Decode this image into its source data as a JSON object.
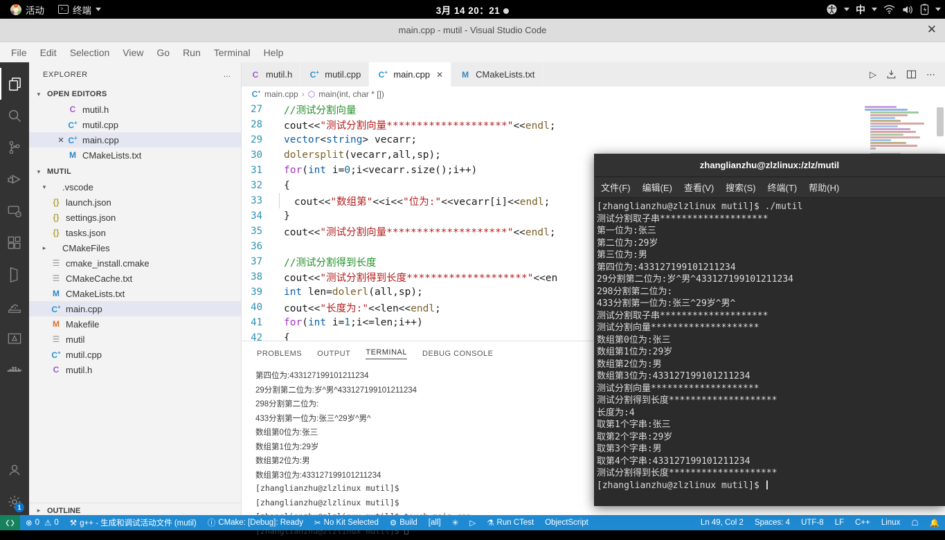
{
  "gnome_bar": {
    "activities": "活动",
    "app_menu": "终端",
    "clock": "3月 14  20：21",
    "icons": [
      "ubuntu-logo-icon",
      "terminal-icon",
      "chevron-down-icon",
      "accessibility-icon",
      "input-method-icon",
      "wifi-icon",
      "volume-icon",
      "battery-icon",
      "power-chevron-icon"
    ],
    "input_method": "中"
  },
  "vscode": {
    "title": "main.cpp - mutil - Visual Studio Code",
    "close_label": "✕",
    "menus": [
      "File",
      "Edit",
      "Selection",
      "View",
      "Go",
      "Run",
      "Terminal",
      "Help"
    ],
    "activity_bar": [
      {
        "name": "explorer",
        "icon": "files-icon",
        "active": true
      },
      {
        "name": "search",
        "icon": "search-icon",
        "active": false
      },
      {
        "name": "source-control",
        "icon": "source-control-icon",
        "active": false
      },
      {
        "name": "run-and-debug",
        "icon": "debug-icon",
        "active": false
      },
      {
        "name": "remote-explorer",
        "icon": "remote-icon",
        "active": false
      },
      {
        "name": "extensions",
        "icon": "extensions-icon",
        "active": false
      },
      {
        "name": "cmake",
        "icon": "cmake-icon",
        "active": false
      },
      {
        "name": "testing",
        "icon": "beaker-icon",
        "active": false
      },
      {
        "name": "objectscript",
        "icon": "objectscript-icon",
        "active": false
      },
      {
        "name": "docker",
        "icon": "docker-icon",
        "active": false
      }
    ],
    "activity_bar_bottom": [
      {
        "name": "accounts",
        "icon": "account-icon"
      },
      {
        "name": "manage",
        "icon": "gear-icon",
        "badge": "1"
      }
    ],
    "sidebar": {
      "title": "EXPLORER",
      "more_actions": "…",
      "open_editors": {
        "label": "OPEN EDITORS",
        "items": [
          {
            "name": "mutil.h",
            "icon": "c-file-icon",
            "selected": false,
            "closable": false
          },
          {
            "name": "mutil.cpp",
            "icon": "cpp-file-icon",
            "selected": false,
            "closable": false
          },
          {
            "name": "main.cpp",
            "icon": "cpp-file-icon",
            "selected": true,
            "closable": true
          },
          {
            "name": "CMakeLists.txt",
            "icon": "cmake-file-icon",
            "selected": false,
            "closable": false
          }
        ]
      },
      "project": {
        "label": "MUTIL",
        "items": [
          {
            "name": ".vscode",
            "icon": "folder-open-icon",
            "indent": 1,
            "twisty": "▾",
            "selected": false
          },
          {
            "name": "launch.json",
            "icon": "json-file-icon",
            "indent": 2,
            "twisty": "",
            "selected": false
          },
          {
            "name": "settings.json",
            "icon": "json-file-icon",
            "indent": 2,
            "twisty": "",
            "selected": false
          },
          {
            "name": "tasks.json",
            "icon": "json-file-icon",
            "indent": 2,
            "twisty": "",
            "selected": false
          },
          {
            "name": "CMakeFiles",
            "icon": "folder-icon",
            "indent": 1,
            "twisty": "▸",
            "selected": false
          },
          {
            "name": "cmake_install.cmake",
            "icon": "text-file-icon",
            "indent": 1,
            "twisty": "",
            "selected": false
          },
          {
            "name": "CMakeCache.txt",
            "icon": "text-file-icon",
            "indent": 1,
            "twisty": "",
            "selected": false
          },
          {
            "name": "CMakeLists.txt",
            "icon": "cmake-file-icon",
            "indent": 1,
            "twisty": "",
            "selected": false
          },
          {
            "name": "main.cpp",
            "icon": "cpp-file-icon",
            "indent": 1,
            "twisty": "",
            "selected": true
          },
          {
            "name": "Makefile",
            "icon": "makefile-icon",
            "indent": 1,
            "twisty": "",
            "selected": false
          },
          {
            "name": "mutil",
            "icon": "text-file-icon",
            "indent": 1,
            "twisty": "",
            "selected": false
          },
          {
            "name": "mutil.cpp",
            "icon": "cpp-file-icon",
            "indent": 1,
            "twisty": "",
            "selected": false
          },
          {
            "name": "mutil.h",
            "icon": "c-file-icon",
            "indent": 1,
            "twisty": "",
            "selected": false
          }
        ]
      },
      "outline_label": "OUTLINE"
    },
    "tabs": [
      {
        "label": "mutil.h",
        "icon": "c-file-icon",
        "active": false,
        "closable": false
      },
      {
        "label": "mutil.cpp",
        "icon": "cpp-file-icon",
        "active": false,
        "closable": false
      },
      {
        "label": "main.cpp",
        "icon": "cpp-file-icon",
        "active": true,
        "closable": true
      },
      {
        "label": "CMakeLists.txt",
        "icon": "cmake-file-icon",
        "active": false,
        "closable": false
      }
    ],
    "editor_actions": [
      "run-icon",
      "run-debug-icon",
      "split-editor-icon",
      "more-actions-icon"
    ],
    "breadcrumbs": [
      "main.cpp",
      "main(int, char * [])"
    ],
    "code_lines": [
      {
        "num": "27",
        "indent": 1,
        "tokens": [
          {
            "t": "//测试分割向量",
            "c": "k-cmt"
          }
        ]
      },
      {
        "num": "28",
        "indent": 1,
        "tokens": [
          {
            "t": "cout",
            "c": "k-plain"
          },
          {
            "t": "<<",
            "c": "k-plain"
          },
          {
            "t": "\"测试分割向量********************\"",
            "c": "k-str"
          },
          {
            "t": "<<",
            "c": "k-plain"
          },
          {
            "t": "endl",
            "c": "k-fn"
          },
          {
            "t": ";",
            "c": "k-plain"
          }
        ]
      },
      {
        "num": "29",
        "indent": 1,
        "tokens": [
          {
            "t": "vector",
            "c": "k-type"
          },
          {
            "t": "<",
            "c": "k-plain"
          },
          {
            "t": "string",
            "c": "k-type"
          },
          {
            "t": "> vecarr;",
            "c": "k-plain"
          }
        ]
      },
      {
        "num": "30",
        "indent": 1,
        "tokens": [
          {
            "t": "dolersplit",
            "c": "k-fn"
          },
          {
            "t": "(vecarr,all,sp);",
            "c": "k-plain"
          }
        ]
      },
      {
        "num": "31",
        "indent": 1,
        "tokens": [
          {
            "t": "for",
            "c": "k-kw"
          },
          {
            "t": "(",
            "c": "k-plain"
          },
          {
            "t": "int",
            "c": "k-type"
          },
          {
            "t": " i=",
            "c": "k-plain"
          },
          {
            "t": "0",
            "c": "k-num"
          },
          {
            "t": ";i<vecarr.size();i++)",
            "c": "k-plain"
          }
        ]
      },
      {
        "num": "32",
        "indent": 1,
        "tokens": [
          {
            "t": "{",
            "c": "k-plain"
          }
        ]
      },
      {
        "num": "33",
        "indent": 2,
        "tokens": [
          {
            "t": "cout<<",
            "c": "k-plain"
          },
          {
            "t": "\"数组第\"",
            "c": "k-str"
          },
          {
            "t": "<<i<<",
            "c": "k-plain"
          },
          {
            "t": "\"位为:\"",
            "c": "k-str"
          },
          {
            "t": "<<vecarr[i]<<",
            "c": "k-plain"
          },
          {
            "t": "endl",
            "c": "k-fn"
          },
          {
            "t": ";",
            "c": "k-plain"
          }
        ]
      },
      {
        "num": "34",
        "indent": 1,
        "tokens": [
          {
            "t": "}",
            "c": "k-plain"
          }
        ]
      },
      {
        "num": "35",
        "indent": 1,
        "tokens": [
          {
            "t": "cout<<",
            "c": "k-plain"
          },
          {
            "t": "\"测试分割向量********************\"",
            "c": "k-str"
          },
          {
            "t": "<<",
            "c": "k-plain"
          },
          {
            "t": "endl",
            "c": "k-fn"
          },
          {
            "t": ";",
            "c": "k-plain"
          }
        ]
      },
      {
        "num": "36",
        "indent": 0,
        "tokens": []
      },
      {
        "num": "37",
        "indent": 1,
        "tokens": [
          {
            "t": "//测试分割得到长度",
            "c": "k-cmt"
          }
        ]
      },
      {
        "num": "38",
        "indent": 1,
        "tokens": [
          {
            "t": "cout<<",
            "c": "k-plain"
          },
          {
            "t": "\"测试分割得到长度********************\"",
            "c": "k-str"
          },
          {
            "t": "<<en",
            "c": "k-plain"
          }
        ]
      },
      {
        "num": "39",
        "indent": 1,
        "tokens": [
          {
            "t": "int",
            "c": "k-type"
          },
          {
            "t": " len=",
            "c": "k-plain"
          },
          {
            "t": "dolerl",
            "c": "k-fn"
          },
          {
            "t": "(all,sp);",
            "c": "k-plain"
          }
        ]
      },
      {
        "num": "40",
        "indent": 1,
        "tokens": [
          {
            "t": "cout<<",
            "c": "k-plain"
          },
          {
            "t": "\"长度为:\"",
            "c": "k-str"
          },
          {
            "t": "<<len<<",
            "c": "k-plain"
          },
          {
            "t": "endl",
            "c": "k-fn"
          },
          {
            "t": ";",
            "c": "k-plain"
          }
        ]
      },
      {
        "num": "41",
        "indent": 1,
        "tokens": [
          {
            "t": "for",
            "c": "k-kw"
          },
          {
            "t": "(",
            "c": "k-plain"
          },
          {
            "t": "int",
            "c": "k-type"
          },
          {
            "t": " i=",
            "c": "k-plain"
          },
          {
            "t": "1",
            "c": "k-num"
          },
          {
            "t": ";i<=len;i++)",
            "c": "k-plain"
          }
        ]
      },
      {
        "num": "42",
        "indent": 1,
        "tokens": [
          {
            "t": "{",
            "c": "k-plain"
          }
        ]
      }
    ],
    "panel": {
      "tabs": [
        "PROBLEMS",
        "OUTPUT",
        "TERMINAL",
        "DEBUG CONSOLE"
      ],
      "active_tab": "TERMINAL",
      "lines": [
        {
          "text": "第四位为:433127199101211234",
          "mono": false
        },
        {
          "text": "29分割第二位为:岁^男^433127199101211234",
          "mono": false
        },
        {
          "text": "298分割第二位为:",
          "mono": false
        },
        {
          "text": "433分割第一位为:张三^29岁^男^",
          "mono": false
        },
        {
          "text": "数组第0位为:张三",
          "mono": false
        },
        {
          "text": "数组第1位为:29岁",
          "mono": false
        },
        {
          "text": "数组第2位为:男",
          "mono": false
        },
        {
          "text": "数组第3位为:433127199101211234",
          "mono": false
        },
        {
          "text": "[zhanglianzhu@zlzlinux mutil]$ ",
          "mono": true
        },
        {
          "text": "[zhanglianzhu@zlzlinux mutil]$ ",
          "mono": true
        },
        {
          "text": "[zhanglianzhu@zlzlinux mutil]$ touch main.cpp",
          "mono": true
        },
        {
          "text": "[zhanglianzhu@zlzlinux mutil]$ ",
          "mono": true,
          "cursor": true
        }
      ]
    },
    "status_bar": {
      "remote_icon": "remote-indicator-icon",
      "problems": "0",
      "warnings": "0",
      "build_target": "g++ - 生成和调试活动文件 (mutil)",
      "cmake_status": "CMake: [Debug]: Ready",
      "kit": "No Kit Selected",
      "build": "Build",
      "variant": "[all]",
      "debug_icon": "bug-icon",
      "launch_icon": "play-icon",
      "ctest": "Run CTest",
      "objectscript": "ObjectScript",
      "cursor_position": "Ln 49, Col 2",
      "indentation": "Spaces: 4",
      "encoding": "UTF-8",
      "eol": "LF",
      "language": "C++",
      "platform": "Linux",
      "feedback_icon": "feedback-icon",
      "notifications_icon": "bell-icon"
    }
  },
  "gnome_terminal": {
    "title": "zhanglianzhu@zlzlinux:/zlz/mutil",
    "menus": [
      "文件(F)",
      "编辑(E)",
      "查看(V)",
      "搜索(S)",
      "终端(T)",
      "帮助(H)"
    ],
    "lines": [
      "[zhanglianzhu@zlzlinux mutil]$ ./mutil",
      "测试分割取子串********************",
      "第一位为:张三",
      "第二位为:29岁",
      "第三位为:男",
      "第四位为:433127199101211234",
      "29分割第二位为:岁^男^433127199101211234",
      "298分割第二位为:",
      "433分割第一位为:张三^29岁^男^",
      "测试分割取子串********************",
      "测试分割向量********************",
      "数组第0位为:张三",
      "数组第1位为:29岁",
      "数组第2位为:男",
      "数组第3位为:433127199101211234",
      "测试分割向量********************",
      "测试分割得到长度********************",
      "长度为:4",
      "取第1个字串:张三",
      "取第2个字串:29岁",
      "取第3个字串:男",
      "取第4个字串:433127199101211234",
      "测试分割得到长度********************"
    ],
    "prompt": "[zhanglianzhu@zlzlinux mutil]$ "
  },
  "colors": {
    "status_bar": "#1f8ad2",
    "remote_badge": "#16825d",
    "activity_bar": "#333333",
    "sidebar": "#f3f3f3",
    "terminal_bg": "#2b2b2b",
    "selection": "#e4e6f1"
  }
}
